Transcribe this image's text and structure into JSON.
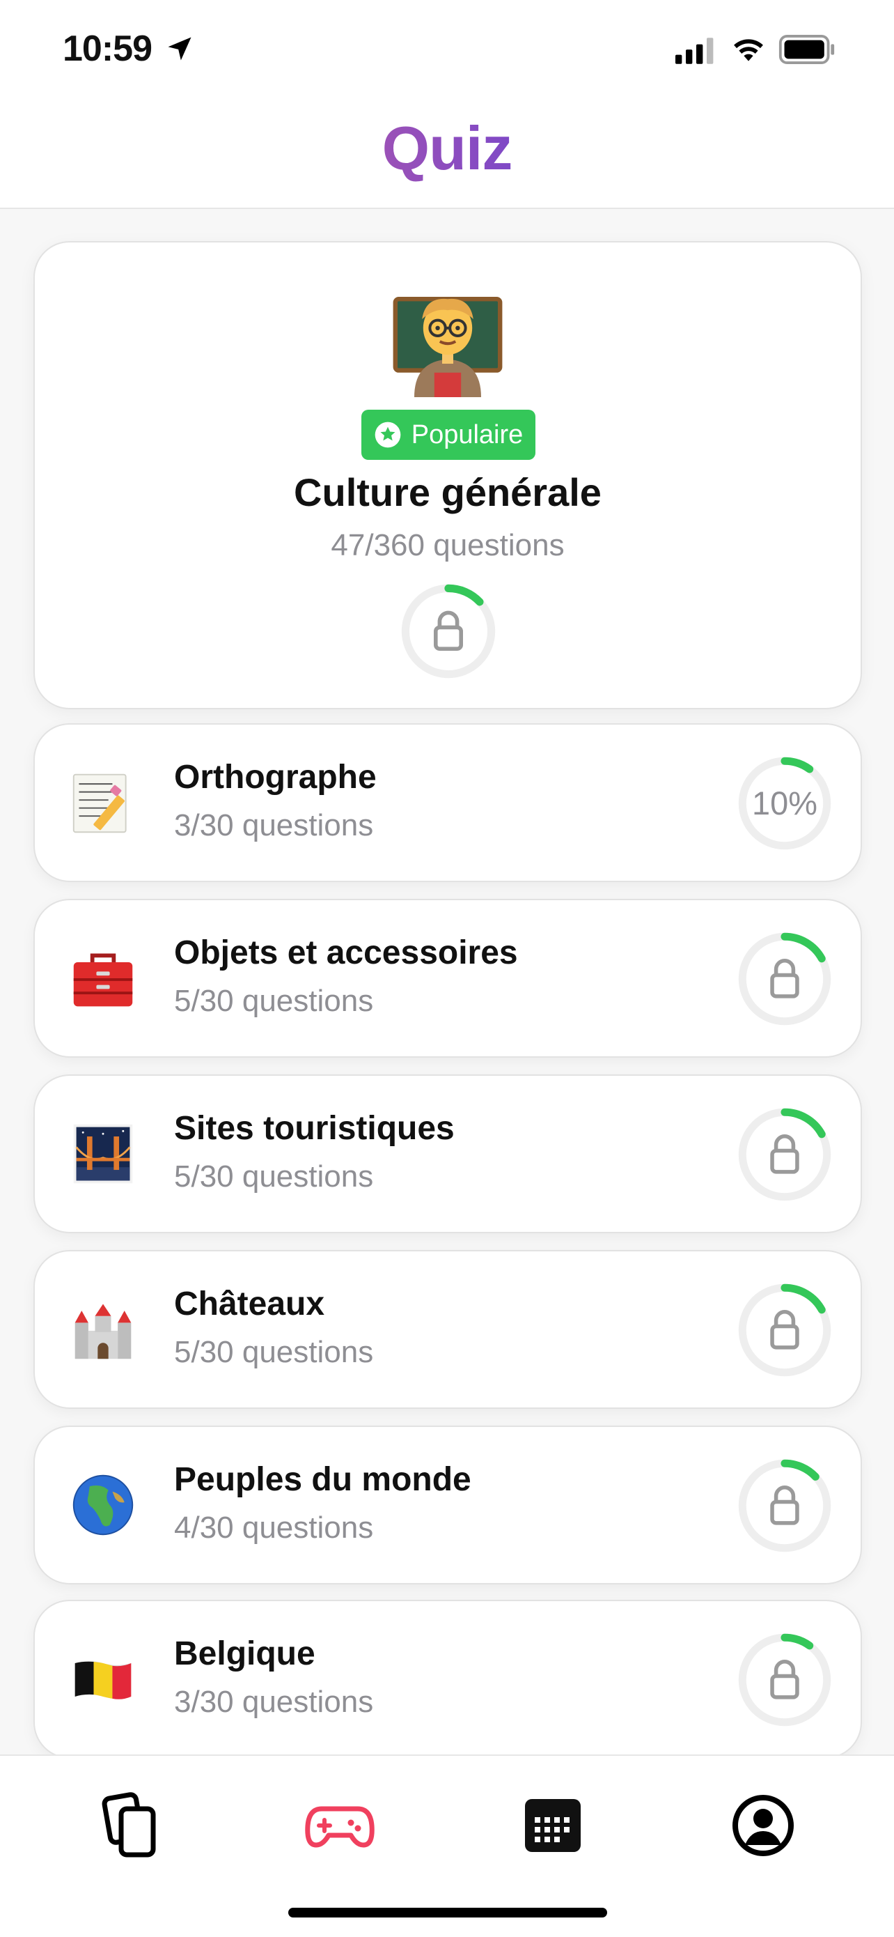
{
  "status_bar": {
    "time": "10:59"
  },
  "header": {
    "title": "Quiz"
  },
  "featured": {
    "emoji": "teacher",
    "badge": "Populaire",
    "title": "Culture générale",
    "subtitle": "47/360 questions",
    "progress": 0.13,
    "locked": true
  },
  "categories": [
    {
      "title": "Orthographe",
      "subtitle": "3/30 questions",
      "progress": 0.1,
      "ring_label": "10%",
      "locked": false,
      "emoji": "memo"
    },
    {
      "title": "Objets et accessoires",
      "subtitle": "5/30 questions",
      "progress": 0.17,
      "locked": true,
      "emoji": "toolbox"
    },
    {
      "title": "Sites touristiques",
      "subtitle": "5/30 questions",
      "progress": 0.17,
      "locked": true,
      "emoji": "bridge-at-night"
    },
    {
      "title": "Châteaux",
      "subtitle": "5/30 questions",
      "progress": 0.17,
      "locked": true,
      "emoji": "castle"
    },
    {
      "title": "Peuples du monde",
      "subtitle": "4/30 questions",
      "progress": 0.13,
      "locked": true,
      "emoji": "globe"
    },
    {
      "title": "Belgique",
      "subtitle": "3/30 questions",
      "progress": 0.1,
      "locked": true,
      "emoji": "belgium-flag"
    }
  ],
  "tabbar": {
    "tabs": [
      {
        "icon": "cards-icon",
        "active": false
      },
      {
        "icon": "gamepad-icon",
        "active": true
      },
      {
        "icon": "calendar-icon",
        "active": false
      },
      {
        "icon": "profile-icon",
        "active": false
      }
    ]
  },
  "colors": {
    "accent_green": "#34c759",
    "ring_track": "#eeeeee",
    "tab_active": "#f0405e",
    "title_gradient": [
      "#ec6b8a",
      "#3b2fc9"
    ]
  }
}
